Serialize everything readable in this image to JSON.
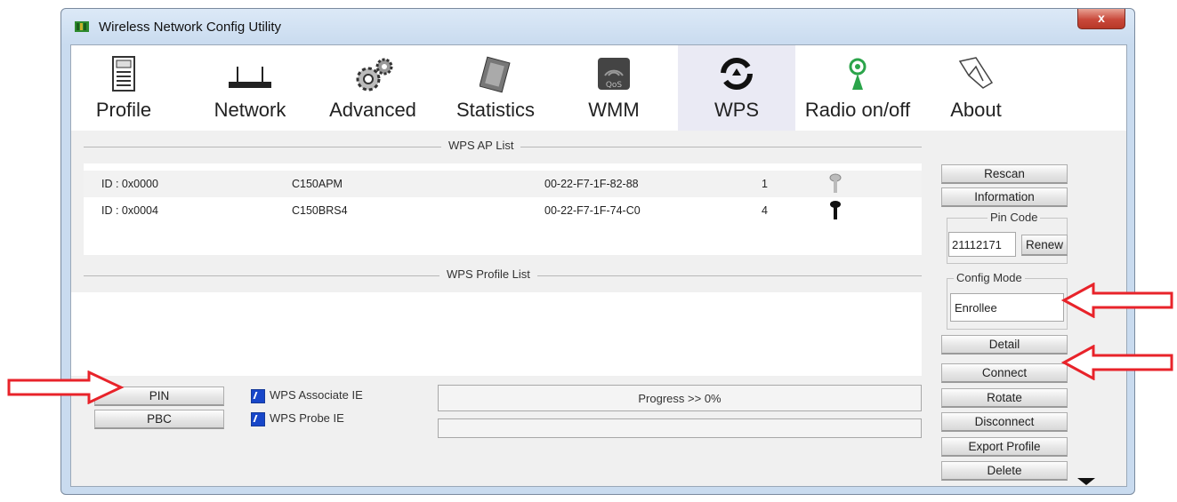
{
  "window": {
    "title": "Wireless Network Config Utility",
    "close_glyph": "x"
  },
  "toolbar": {
    "items": [
      {
        "label": "Profile",
        "icon": "profile-icon"
      },
      {
        "label": "Network",
        "icon": "router-icon"
      },
      {
        "label": "Advanced",
        "icon": "gears-icon"
      },
      {
        "label": "Statistics",
        "icon": "statistics-icon"
      },
      {
        "label": "WMM",
        "icon": "qos-icon"
      },
      {
        "label": "WPS",
        "icon": "wps-icon",
        "active": true
      },
      {
        "label": "Radio on/off",
        "icon": "radio-icon"
      },
      {
        "label": "About",
        "icon": "about-icon"
      }
    ]
  },
  "wps_ap_list": {
    "title": "WPS AP List",
    "rows": [
      {
        "id": "ID : 0x0000",
        "ssid": "C150APM",
        "bssid": "00-22-F7-1F-82-88",
        "channel": "1",
        "icon": "key-gray-icon"
      },
      {
        "id": "ID : 0x0004",
        "ssid": "C150BRS4",
        "bssid": "00-22-F7-1F-74-C0",
        "channel": "4",
        "icon": "key-black-icon"
      }
    ]
  },
  "wps_profile_list": {
    "title": "WPS Profile List"
  },
  "bottom": {
    "pin_label": "PIN",
    "pbc_label": "PBC",
    "associate_label": "WPS Associate IE",
    "probe_label": "WPS Probe IE",
    "progress_text": "Progress >> 0%"
  },
  "side": {
    "rescan": "Rescan",
    "information": "Information",
    "pin_code_title": "Pin Code",
    "pin_code_value": "21112171",
    "renew": "Renew",
    "config_mode_title": "Config Mode",
    "config_mode_value": "Enrollee",
    "detail": "Detail",
    "connect": "Connect",
    "rotate": "Rotate",
    "disconnect": "Disconnect",
    "export_profile": "Export Profile",
    "delete": "Delete"
  },
  "annotation_color": "#e8232a"
}
